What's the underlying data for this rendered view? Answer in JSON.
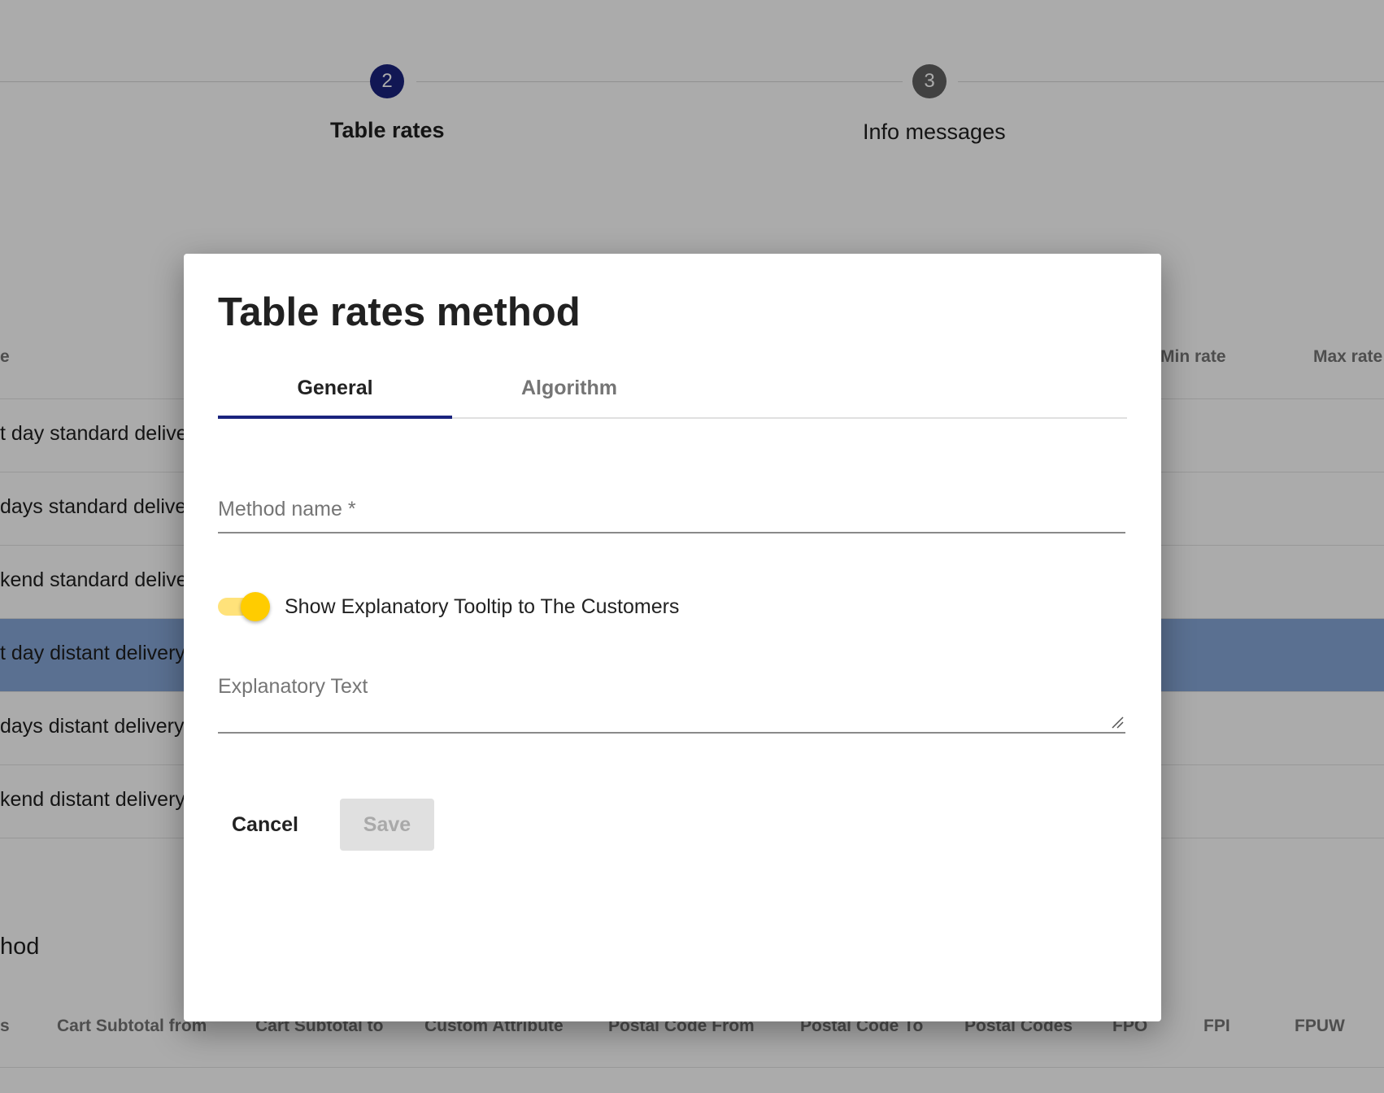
{
  "stepper": {
    "steps": [
      {
        "number": "2",
        "label": "Table rates",
        "color": "#1a237e"
      },
      {
        "number": "3",
        "label": "Info messages",
        "color": "#616161"
      }
    ]
  },
  "methods_table": {
    "headers": [
      "e",
      "Min rate",
      "Max rate"
    ],
    "rows": [
      {
        "name": "t day standard delive"
      },
      {
        "name": "days standard deliver"
      },
      {
        "name": "kend standard delive"
      },
      {
        "name": "t day distant delivery",
        "selected": true
      },
      {
        "name": "days distant delivery"
      },
      {
        "name": "kend distant delivery"
      }
    ]
  },
  "rates_section": {
    "title": "hod",
    "headers": [
      "s",
      "Cart Subtotal from",
      "Cart Subtotal to",
      "Custom Attribute",
      "Postal Code From",
      "Postal Code To",
      "Postal Codes",
      "FPO",
      "FPI",
      "FPUW"
    ]
  },
  "dialog": {
    "title": "Table rates method",
    "tabs": [
      {
        "label": "General",
        "active": true
      },
      {
        "label": "Algorithm",
        "active": false
      }
    ],
    "method_name": {
      "value": "",
      "placeholder": "Method name *"
    },
    "tooltip_toggle": {
      "label": "Show Explanatory Tooltip to The Customers",
      "on": true
    },
    "explanatory_text": {
      "value": "",
      "placeholder": "Explanatory Text"
    },
    "buttons": {
      "cancel": "Cancel",
      "save": "Save"
    }
  },
  "colors": {
    "primary": "#1a237e",
    "accent": "#ffcc00",
    "selected_row": "#86a7d9"
  }
}
